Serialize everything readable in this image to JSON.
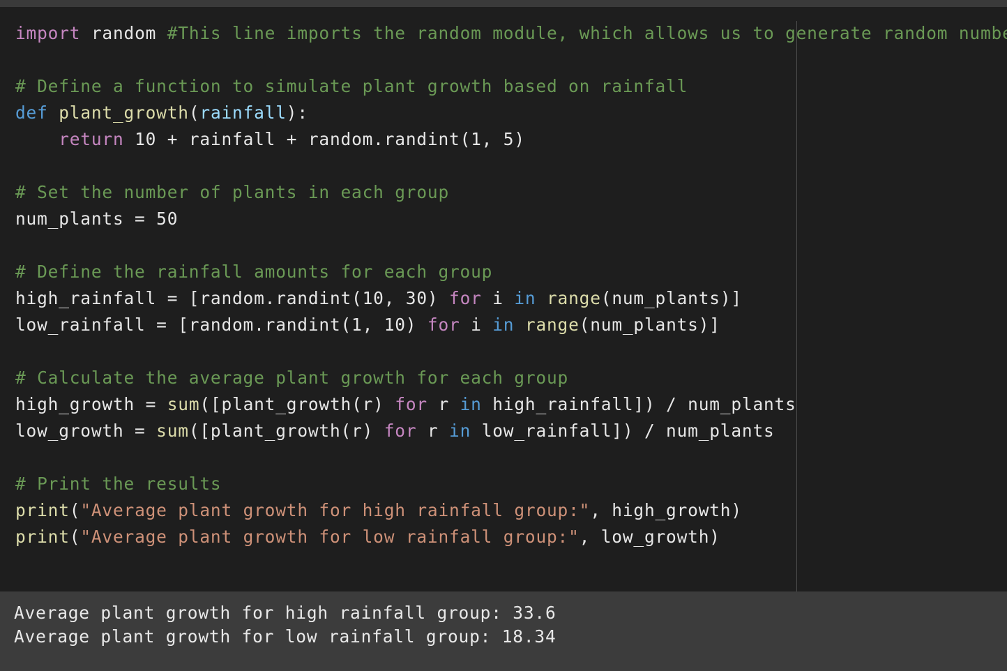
{
  "code": {
    "lines": [
      [
        {
          "t": "import",
          "c": "kw"
        },
        {
          "t": " random ",
          "c": "tx"
        },
        {
          "t": "#This line imports the random module, which allows us to generate random numbers.",
          "c": "cm"
        }
      ],
      [],
      [
        {
          "t": "# Define a function to simulate plant growth based on rainfall",
          "c": "cm"
        }
      ],
      [
        {
          "t": "def",
          "c": "kwb"
        },
        {
          "t": " ",
          "c": "tx"
        },
        {
          "t": "plant_growth",
          "c": "fn"
        },
        {
          "t": "(",
          "c": "tx"
        },
        {
          "t": "rainfall",
          "c": "pm"
        },
        {
          "t": "):",
          "c": "tx"
        }
      ],
      [
        {
          "t": "    ",
          "c": "tx"
        },
        {
          "t": "return",
          "c": "kw"
        },
        {
          "t": " 10 + rainfall + random.randint(1, 5)",
          "c": "tx"
        }
      ],
      [],
      [
        {
          "t": "# Set the number of plants in each group",
          "c": "cm"
        }
      ],
      [
        {
          "t": "num_plants = 50",
          "c": "tx"
        }
      ],
      [],
      [
        {
          "t": "# Define the rainfall amounts for each group",
          "c": "cm"
        }
      ],
      [
        {
          "t": "high_rainfall = [random.randint(10, 30) ",
          "c": "tx"
        },
        {
          "t": "for",
          "c": "kw"
        },
        {
          "t": " i ",
          "c": "tx"
        },
        {
          "t": "in",
          "c": "kwb"
        },
        {
          "t": " ",
          "c": "tx"
        },
        {
          "t": "range",
          "c": "fn"
        },
        {
          "t": "(num_plants)]",
          "c": "tx"
        }
      ],
      [
        {
          "t": "low_rainfall = [random.randint(1, 10) ",
          "c": "tx"
        },
        {
          "t": "for",
          "c": "kw"
        },
        {
          "t": " i ",
          "c": "tx"
        },
        {
          "t": "in",
          "c": "kwb"
        },
        {
          "t": " ",
          "c": "tx"
        },
        {
          "t": "range",
          "c": "fn"
        },
        {
          "t": "(num_plants)]",
          "c": "tx"
        }
      ],
      [],
      [
        {
          "t": "# Calculate the average plant growth for each group",
          "c": "cm"
        }
      ],
      [
        {
          "t": "high_growth = ",
          "c": "tx"
        },
        {
          "t": "sum",
          "c": "fn"
        },
        {
          "t": "([plant_growth(r) ",
          "c": "tx"
        },
        {
          "t": "for",
          "c": "kw"
        },
        {
          "t": " r ",
          "c": "tx"
        },
        {
          "t": "in",
          "c": "kwb"
        },
        {
          "t": " high_rainfall]) / num_plants",
          "c": "tx"
        }
      ],
      [
        {
          "t": "low_growth = ",
          "c": "tx"
        },
        {
          "t": "sum",
          "c": "fn"
        },
        {
          "t": "([plant_growth(r) ",
          "c": "tx"
        },
        {
          "t": "for",
          "c": "kw"
        },
        {
          "t": " r ",
          "c": "tx"
        },
        {
          "t": "in",
          "c": "kwb"
        },
        {
          "t": " low_rainfall]) / num_plants",
          "c": "tx"
        }
      ],
      [],
      [
        {
          "t": "# Print the results",
          "c": "cm"
        }
      ],
      [
        {
          "t": "print",
          "c": "fn"
        },
        {
          "t": "(",
          "c": "tx"
        },
        {
          "t": "\"Average plant growth for high rainfall group:\"",
          "c": "st"
        },
        {
          "t": ", high_growth)",
          "c": "tx"
        }
      ],
      [
        {
          "t": "print",
          "c": "fn"
        },
        {
          "t": "(",
          "c": "tx"
        },
        {
          "t": "\"Average plant growth for low rainfall group:\"",
          "c": "st"
        },
        {
          "t": ", low_growth)",
          "c": "tx"
        }
      ]
    ]
  },
  "output": {
    "line1": "Average plant growth for high rainfall group: 33.6",
    "line2": "Average plant growth for low rainfall group: 18.34"
  },
  "colors": {
    "background": "#1e1e1e",
    "output_background": "#3c3c3c",
    "keyword": "#c586c0",
    "keyword_blue": "#569cd6",
    "comment": "#6a9955",
    "string": "#ce9178",
    "function": "#dcdcaa",
    "parameter": "#9cdcfe",
    "text": "#e6e6e6"
  }
}
